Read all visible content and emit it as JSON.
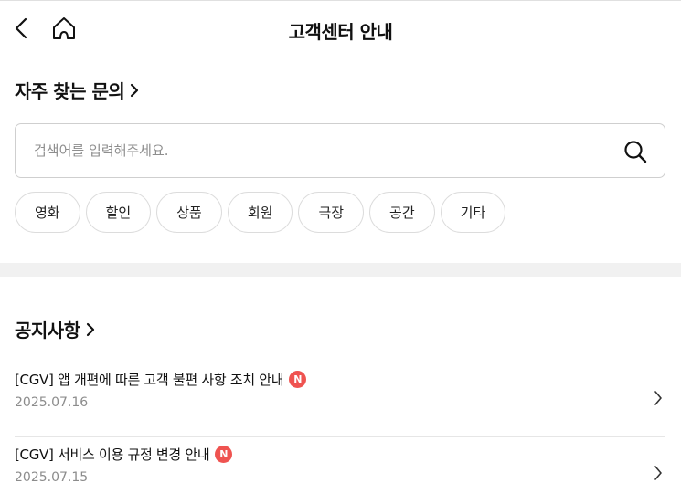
{
  "header": {
    "title": "고객센터 안내",
    "back_icon": "chevron-left-icon",
    "home_icon": "home-icon"
  },
  "faq": {
    "title": "자주 찾는 문의",
    "search_placeholder": "검색어를 입력해주세요.",
    "search_icon": "search-icon",
    "categories": [
      "영화",
      "할인",
      "상품",
      "회원",
      "극장",
      "공간",
      "기타"
    ]
  },
  "notices": {
    "title": "공지사항",
    "items": [
      {
        "title": "[CGV] 앱 개편에 따른 고객 불편 사항 조치 안내",
        "date": "2025.07.16",
        "badge": "N"
      },
      {
        "title": "[CGV] 서비스 이용 규정 변경 안내",
        "date": "2025.07.15",
        "badge": "N"
      }
    ]
  },
  "colors": {
    "badge": "#ef5350",
    "divider": "#f1f1f1",
    "border": "#cfcfcf",
    "muted_text": "#8c8c8c"
  }
}
